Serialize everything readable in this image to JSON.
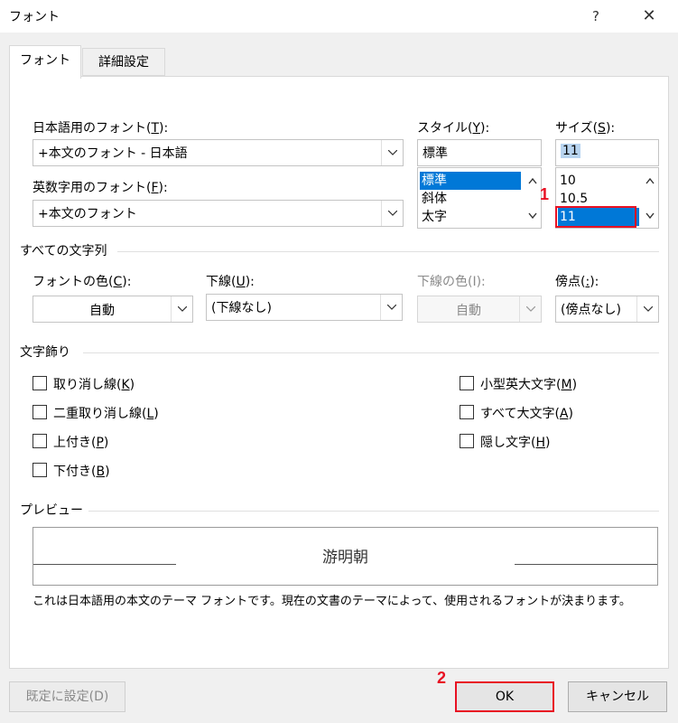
{
  "window": {
    "title": "フォント",
    "help_label": "?",
    "close_label": "✕"
  },
  "tabs": [
    {
      "label": "フォント",
      "active": true
    },
    {
      "label": "詳細設定",
      "active": false
    }
  ],
  "japanese_font": {
    "label": "日本語用のフォント(",
    "accel": "T",
    "label_end": "):",
    "value": "+本文のフォント - 日本語"
  },
  "western_font": {
    "label": "英数字用のフォント(",
    "accel": "F",
    "label_end": "):",
    "value": "+本文のフォント"
  },
  "style": {
    "label": "スタイル(",
    "accel": "Y",
    "label_end": "):",
    "value": "標準",
    "options": [
      "標準",
      "斜体",
      "太字"
    ],
    "selected": "標準"
  },
  "size": {
    "label": "サイズ(",
    "accel": "S",
    "label_end": "):",
    "value": "11",
    "options": [
      "10",
      "10.5",
      "11"
    ],
    "selected": "11"
  },
  "all_text_section": "すべての文字列",
  "font_color": {
    "label": "フォントの色(",
    "accel": "C",
    "label_end": "):",
    "value": "自動"
  },
  "underline": {
    "label": "下線(",
    "accel": "U",
    "label_end": "):",
    "value": "(下線なし)"
  },
  "underline_color": {
    "label": "下線の色(I):",
    "value": "自動"
  },
  "emphasis": {
    "label": "傍点(",
    "accel": ":",
    "label_end": "):",
    "value": "(傍点なし)"
  },
  "effects_section": "文字飾り",
  "effects_left": [
    {
      "label": "取り消し線(",
      "accel": "K",
      "end": ")",
      "checked": false
    },
    {
      "label": "二重取り消し線(",
      "accel": "L",
      "end": ")",
      "checked": false
    },
    {
      "label": "上付き(",
      "accel": "P",
      "end": ")",
      "checked": false
    },
    {
      "label": "下付き(",
      "accel": "B",
      "end": ")",
      "checked": false
    }
  ],
  "effects_right": [
    {
      "label": "小型英大文字(",
      "accel": "M",
      "end": ")",
      "checked": false
    },
    {
      "label": "すべて大文字(",
      "accel": "A",
      "end": ")",
      "checked": false
    },
    {
      "label": "隠し文字(",
      "accel": "H",
      "end": ")",
      "checked": false
    }
  ],
  "preview_section": "プレビュー",
  "preview_text": "游明朝",
  "description": "これは日本語用の本文のテーマ フォントです。現在の文書のテーマによって、使用されるフォントが決まります。",
  "buttons": {
    "set_default": "既定に設定(D)",
    "ok": "OK",
    "cancel": "キャンセル"
  },
  "annotations": {
    "step1": "1",
    "step2": "2"
  },
  "colors": {
    "selection": "#0078d7",
    "annotation": "#e81123"
  }
}
